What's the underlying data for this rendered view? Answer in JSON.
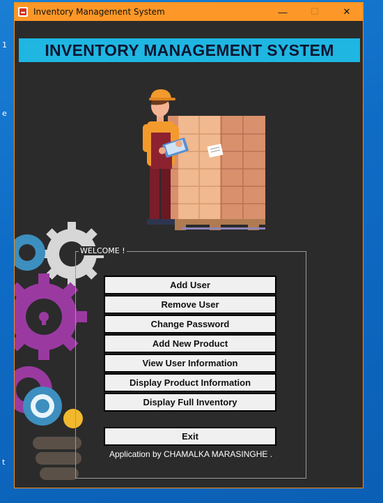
{
  "window": {
    "title": "Inventory Management System",
    "minimize_symbol": "—",
    "maximize_symbol": "☐",
    "close_symbol": "✕"
  },
  "header": {
    "title": "INVENTORY MANAGEMENT SYSTEM"
  },
  "welcome": {
    "label": "WELCOME !",
    "buttons": [
      {
        "label": "Add User"
      },
      {
        "label": "Remove User"
      },
      {
        "label": "Change Password"
      },
      {
        "label": "Add New Product"
      },
      {
        "label": "View User Information"
      },
      {
        "label": "Display Product Information"
      },
      {
        "label": "Display Full Inventory"
      }
    ],
    "exit_label": "Exit",
    "credit": "Application by CHAMALKA MARASINGHE ."
  },
  "desktop": {
    "edge_texts": [
      "1",
      "e",
      "t"
    ]
  },
  "colors": {
    "titlebar": "#fd9727",
    "banner": "#1fb6e2",
    "window_bg": "#2b2b2b"
  },
  "icons": [
    "app-icon",
    "minimize-icon",
    "maximize-icon",
    "close-icon",
    "warehouse-worker-illustration",
    "gears-decoration"
  ]
}
